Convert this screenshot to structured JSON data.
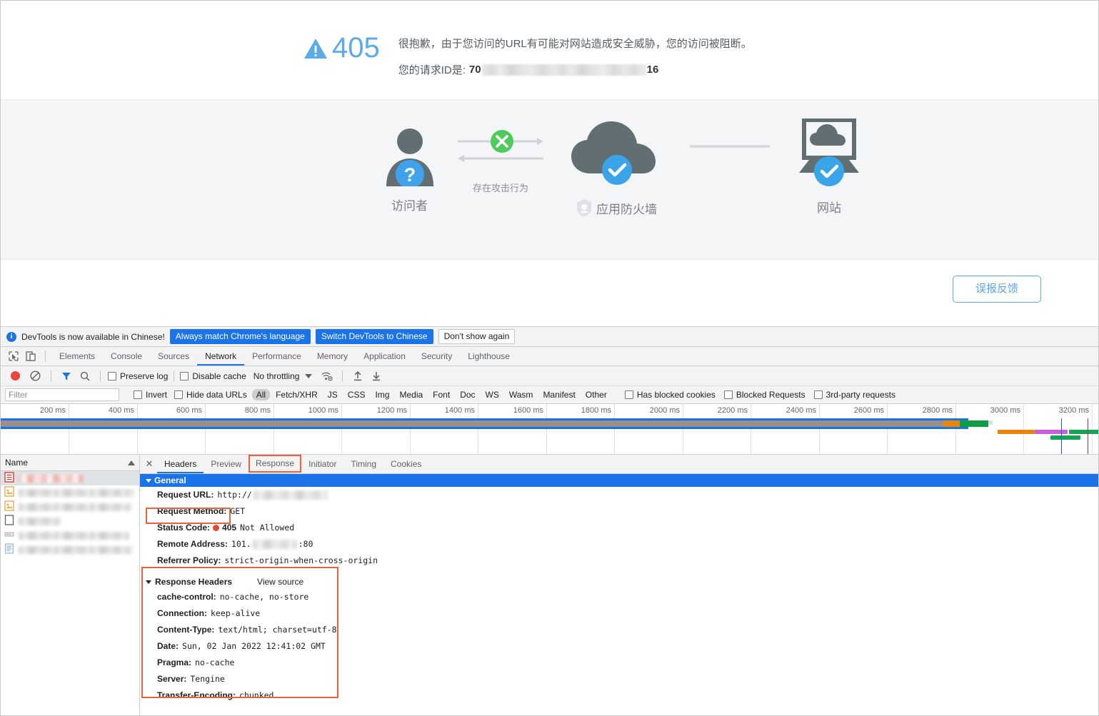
{
  "waf": {
    "status_code": "405",
    "message": "很抱歉，由于您访问的URL有可能对网站造成安全威胁，您的访问被阻断。",
    "request_id_label": "您的请求ID是:",
    "request_id_prefix": "70",
    "request_id_suffix": "16",
    "feedback_button": "误报反馈",
    "accent_blue": "#5aabe8",
    "nodes": [
      {
        "name": "visitor",
        "label": "访问者"
      },
      {
        "name": "waf",
        "label": "应用防火墙"
      },
      {
        "name": "website",
        "label": "网站"
      }
    ],
    "connection_label": "存在攻击行为"
  },
  "devtools": {
    "infobar": {
      "text": "DevTools is now available in Chinese!",
      "buttons": [
        {
          "label": "Always match Chrome's language",
          "style": "blue"
        },
        {
          "label": "Switch DevTools to Chinese",
          "style": "blue"
        },
        {
          "label": "Don't show again",
          "style": "white"
        }
      ]
    },
    "tabs": [
      {
        "label": "Elements",
        "active": false
      },
      {
        "label": "Console",
        "active": false
      },
      {
        "label": "Sources",
        "active": false
      },
      {
        "label": "Network",
        "active": true
      },
      {
        "label": "Performance",
        "active": false
      },
      {
        "label": "Memory",
        "active": false
      },
      {
        "label": "Application",
        "active": false
      },
      {
        "label": "Security",
        "active": false
      },
      {
        "label": "Lighthouse",
        "active": false
      }
    ],
    "network_toolbar": {
      "preserve_log": "Preserve log",
      "disable_cache": "Disable cache",
      "throttling": "No throttling"
    },
    "filter_bar": {
      "filter_placeholder": "Filter",
      "invert": "Invert",
      "hide_data_urls": "Hide data URLs",
      "types": [
        "All",
        "Fetch/XHR",
        "JS",
        "CSS",
        "Img",
        "Media",
        "Font",
        "Doc",
        "WS",
        "Wasm",
        "Manifest",
        "Other"
      ],
      "active_type": "All",
      "has_blocked_cookies": "Has blocked cookies",
      "blocked_requests": "Blocked Requests",
      "third_party_requests": "3rd-party requests"
    },
    "timeline": {
      "ticks": [
        "200 ms",
        "400 ms",
        "600 ms",
        "800 ms",
        "1000 ms",
        "1200 ms",
        "1400 ms",
        "1600 ms",
        "1800 ms",
        "2000 ms",
        "2200 ms",
        "2400 ms",
        "2600 ms",
        "2800 ms",
        "3000 ms",
        "3200 ms"
      ]
    },
    "request_list": {
      "column_header": "Name",
      "rows": [
        {
          "icon": "document-icon",
          "selected": true,
          "redacted_width": 90,
          "redacted_color": "red"
        },
        {
          "icon": "image-icon",
          "selected": false,
          "redacted_width": 162
        },
        {
          "icon": "image-icon",
          "selected": false,
          "redacted_width": 158
        },
        {
          "icon": "blank-icon",
          "selected": false,
          "redacted_width": 60
        },
        {
          "icon": "resource-icon",
          "selected": false,
          "redacted_width": 155
        },
        {
          "icon": "script-icon",
          "selected": false,
          "redacted_width": 160
        }
      ]
    },
    "detail": {
      "tabs": [
        {
          "label": "Headers",
          "active": true,
          "highlighted": false
        },
        {
          "label": "Preview",
          "active": false,
          "highlighted": false
        },
        {
          "label": "Response",
          "active": false,
          "highlighted": true
        },
        {
          "label": "Initiator",
          "active": false,
          "highlighted": false
        },
        {
          "label": "Timing",
          "active": false,
          "highlighted": false
        },
        {
          "label": "Cookies",
          "active": false,
          "highlighted": false
        }
      ],
      "general_section": "General",
      "general": [
        {
          "key": "Request URL:",
          "value": "http://",
          "redacted": true
        },
        {
          "key": "Request Method:",
          "value": "GET",
          "redacted": false
        },
        {
          "key": "Status Code:",
          "value": "405",
          "status_text": "Not Allowed",
          "is_status": true,
          "highlighted": true
        },
        {
          "key": "Remote Address:",
          "value": "101.",
          "value_tail": ":80",
          "redacted": true
        },
        {
          "key": "Referrer Policy:",
          "value": "strict-origin-when-cross-origin",
          "redacted": false
        }
      ],
      "response_headers_title": "Response Headers",
      "view_source": "View source",
      "response_headers": [
        {
          "key": "cache-control:",
          "value": "no-cache, no-store"
        },
        {
          "key": "Connection:",
          "value": "keep-alive"
        },
        {
          "key": "Content-Type:",
          "value": "text/html; charset=utf-8"
        },
        {
          "key": "Date:",
          "value": "Sun, 02 Jan 2022 12:41:02 GMT"
        },
        {
          "key": "Pragma:",
          "value": "no-cache"
        },
        {
          "key": "Server:",
          "value": "Tengine"
        },
        {
          "key": "Transfer-Encoding:",
          "value": "chunked"
        }
      ]
    }
  }
}
